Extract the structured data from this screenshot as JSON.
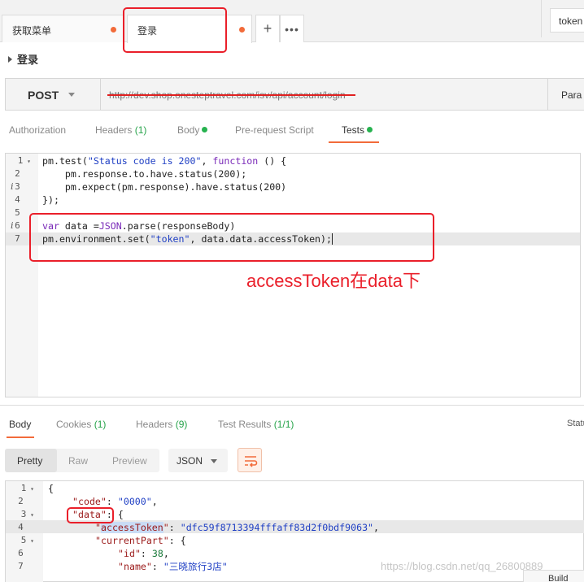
{
  "tabs": [
    {
      "label": "获取菜单"
    },
    {
      "label": "登录"
    }
  ],
  "env": {
    "label": "token"
  },
  "request": {
    "title": "登录",
    "method": "POST",
    "url": "http://dev.shop.onesteptravel.com/isv/api/account/login",
    "params_label": "Para"
  },
  "request_tabs": {
    "authorization": "Authorization",
    "headers": "Headers",
    "headers_count": "(1)",
    "body": "Body",
    "prerequest": "Pre-request Script",
    "tests": "Tests"
  },
  "editor": {
    "line_numbers": [
      "1",
      "2",
      "3",
      "4",
      "5",
      "6",
      "7"
    ],
    "code": {
      "l1a": "pm.test(",
      "l1b": "\"Status code is 200\"",
      "l1c": ", ",
      "l1d": "function",
      "l1e": " () {",
      "l2": "    pm.response.to.have.status(200);",
      "l3": "    pm.expect(pm.response).have.status(200)",
      "l4": "});",
      "l6a": "var",
      "l6b": " data =",
      "l6c": "JSON",
      "l6d": ".parse(responseBody)",
      "l7a": "pm.environment.set(",
      "l7b": "\"token\"",
      "l7c": ", data.data.accessToken);"
    }
  },
  "annotation": "accessToken在data下",
  "response_tabs": {
    "body": "Body",
    "cookies": "Cookies",
    "cookies_count": "(1)",
    "headers": "Headers",
    "headers_count": "(9)",
    "test_results": "Test Results",
    "test_results_count": "(1/1)",
    "status": "Statu"
  },
  "view_modes": [
    "Pretty",
    "Raw",
    "Preview"
  ],
  "format": "JSON",
  "response_body": {
    "line_numbers": [
      "1",
      "2",
      "3",
      "4",
      "5",
      "6",
      "7"
    ],
    "l1": "{",
    "l2_key": "\"code\"",
    "l2_val": "\"0000\"",
    "l3_key": "\"data\"",
    "l3_rest": ": {",
    "l4_key": "accessToken",
    "l4_val": "\"dfc59f8713394fffaff83d2f0bdf9063\"",
    "l5_key": "\"currentPart\"",
    "l5_rest": ": {",
    "l6_key": "\"id\"",
    "l6_val": "38",
    "l7_key": "\"name\"",
    "l7_val": "\"三晓旅行3店\""
  },
  "watermark": "https://blog.csdn.net/qq_26800889",
  "build_label": "Build",
  "colors": {
    "accent": "#f26b3a",
    "annotation": "#ea1f2a",
    "green_dot": "#26b24f"
  }
}
